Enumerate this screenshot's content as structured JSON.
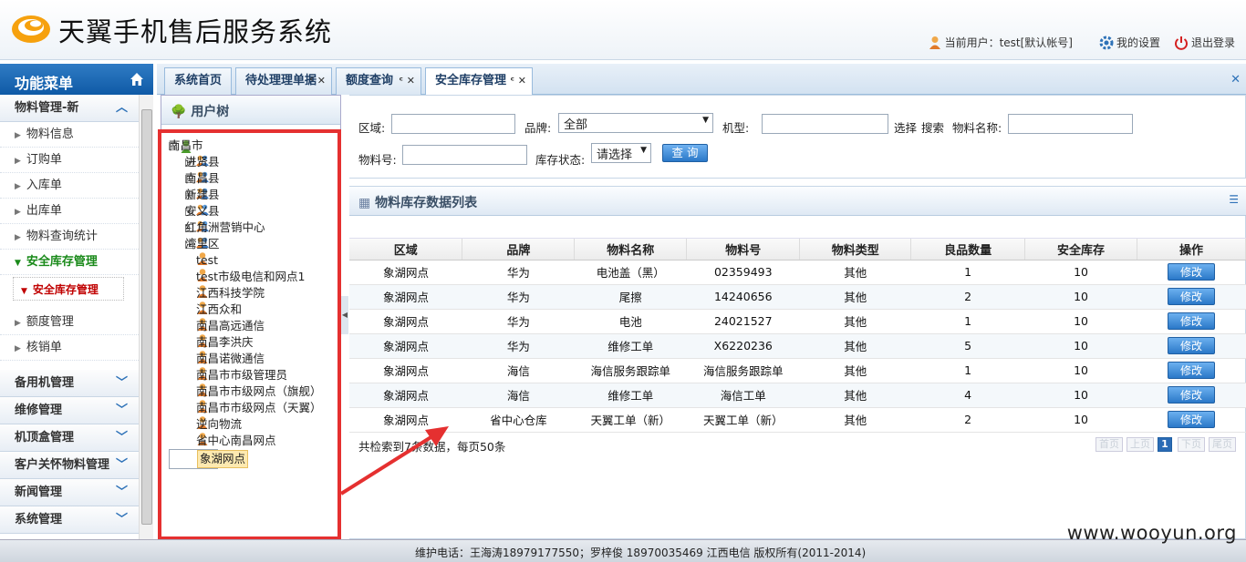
{
  "header": {
    "app_title": "天翼手机售后服务系统",
    "user_label": "当前用户：test[默认帐号]",
    "settings_label": "我的设置",
    "logout_label": "退出登录"
  },
  "sidebar": {
    "title": "功能菜单",
    "group_open": "物料管理-新",
    "items": [
      "物料信息",
      "订购单",
      "入库单",
      "出库单",
      "物料查询统计",
      "安全库存管理"
    ],
    "sub_item": "安全库存管理",
    "items_after": [
      "额度管理",
      "核销单"
    ],
    "groups": [
      "备用机管理",
      "维修管理",
      "机顶盒管理",
      "客户关怀物料管理",
      "新闻管理",
      "系统管理"
    ]
  },
  "tabs": [
    {
      "label": "系统首页"
    },
    {
      "label": "待处理理单据"
    },
    {
      "label": "额度查询"
    },
    {
      "label": "安全库存管理"
    }
  ],
  "tree": {
    "title": "用户树",
    "root": "南昌市",
    "branches": [
      "进贤县",
      "南昌县",
      "新建县",
      "安义县",
      "红角洲营销中心",
      "湾里区"
    ],
    "leaves": [
      "test",
      "test市级电信和网点1",
      "江西科技学院",
      "江西众和",
      "南昌高远通信",
      "南昌李洪庆",
      "南昌诺微通信",
      "南昌市市级管理员",
      "南昌市市级网点（旗舰）",
      "南昌市市级网点（天翼）",
      "逆向物流",
      "省中心南昌网点",
      "象湖网点"
    ]
  },
  "search": {
    "area_label": "区域:",
    "brand_label": "品牌:",
    "brand_value": "全部",
    "model_label": "机型:",
    "select_link": "选择",
    "search_link": "搜索",
    "material_name_label": "物料名称:",
    "material_no_label": "物料号:",
    "stock_status_label": "库存状态:",
    "stock_status_value": "请选择",
    "query_button": "查 询"
  },
  "grid": {
    "title": "物料库存数据列表",
    "columns": [
      "区域",
      "品牌",
      "物料名称",
      "物料号",
      "物料类型",
      "良品数量",
      "安全库存",
      "操作"
    ],
    "rows": [
      [
        "象湖网点",
        "华为",
        "电池盖（黑）",
        "02359493",
        "其他",
        "1",
        "10"
      ],
      [
        "象湖网点",
        "华为",
        "尾擦",
        "14240656",
        "其他",
        "2",
        "10"
      ],
      [
        "象湖网点",
        "华为",
        "电池",
        "24021527",
        "其他",
        "1",
        "10"
      ],
      [
        "象湖网点",
        "华为",
        "维修工单",
        "X6220236",
        "其他",
        "5",
        "10"
      ],
      [
        "象湖网点",
        "海信",
        "海信服务跟踪单",
        "海信服务跟踪单",
        "其他",
        "1",
        "10"
      ],
      [
        "象湖网点",
        "海信",
        "维修工单",
        "海信工单",
        "其他",
        "4",
        "10"
      ],
      [
        "象湖网点",
        "省中心仓库",
        "天翼工单（新）",
        "天翼工单（新）",
        "其他",
        "2",
        "10"
      ]
    ],
    "edit_label": "修改",
    "pager_text": "共检索到7条数据，每页50条",
    "pager": {
      "first": "首页",
      "prev": "上页",
      "current": "1",
      "next": "下页",
      "last": "尾页"
    }
  },
  "footer": {
    "text": "维护电话：王海涛18979177550；罗梓俊 18970035469 江西电信 版权所有(2011-2014)",
    "watermark": "www.wooyun.org"
  },
  "colors": {
    "accent": "#2a78c8",
    "highlight": "#e53030",
    "active_menu": "#1a8a1a"
  }
}
